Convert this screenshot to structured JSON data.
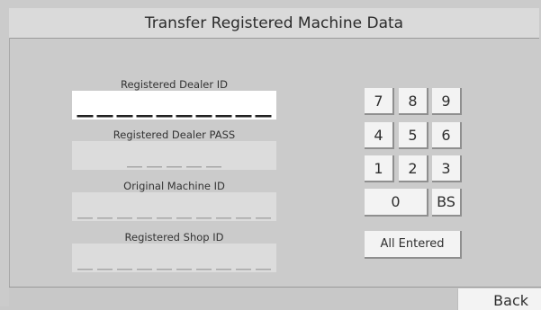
{
  "title": "Transfer Registered Machine Data",
  "fields": [
    {
      "label": "Registered Dealer ID",
      "value": "",
      "slots": 10,
      "active": true
    },
    {
      "label": "Registered Dealer PASS",
      "value": "",
      "slots": 5,
      "active": false
    },
    {
      "label": "Original Machine ID",
      "value": "",
      "slots": 10,
      "active": false
    },
    {
      "label": "Registered Shop ID",
      "value": "",
      "slots": 10,
      "active": false
    }
  ],
  "keypad": {
    "keys": [
      "7",
      "8",
      "9",
      "4",
      "5",
      "6",
      "1",
      "2",
      "3"
    ],
    "zero": "0",
    "backspace": "BS",
    "all_entered": "All Entered"
  },
  "back_label": "Back",
  "colors": {
    "background": "#cbcbcb",
    "active_field": "#ffffff",
    "inactive_field": "#dcdcdc",
    "active_dash": "#222222",
    "inactive_dash": "#a6a6a6",
    "key_face": "#f3f3f3",
    "key_shadow": "#8f8f8f"
  }
}
